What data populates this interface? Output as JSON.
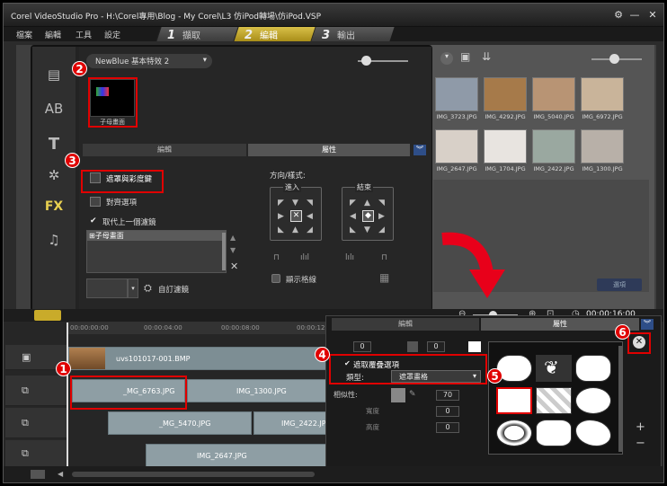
{
  "window": {
    "title": "Corel VideoStudio Pro - H:\\Corel專用\\Blog - My Corel\\L3 仿iPod轉場\\仿iPod.VSP",
    "minimize": "—",
    "restore": "□",
    "close": "✕"
  },
  "menu": {
    "items": [
      "檔案",
      "編輯",
      "工具",
      "設定"
    ]
  },
  "steps": [
    {
      "num": "1",
      "label": "擷取"
    },
    {
      "num": "2",
      "label": "編輯"
    },
    {
      "num": "3",
      "label": "輸出"
    }
  ],
  "library": {
    "thumbs": [
      {
        "label": "IMG_3723.JPG",
        "color": "#8f9aa8"
      },
      {
        "label": "IMG_4292.JPG",
        "color": "#a67a4a"
      },
      {
        "label": "IMG_5040.JPG",
        "color": "#b89474"
      },
      {
        "label": "IMG_6972.JPG",
        "color": "#c9b49a"
      },
      {
        "label": "IMG_2647.JPG",
        "color": "#d8d0c8"
      },
      {
        "label": "IMG_1704.JPG",
        "color": "#e8e4e0"
      },
      {
        "label": "IMG_2422.JPG",
        "color": "#9aa8a0"
      },
      {
        "label": "IMG_1300.JPG",
        "color": "#b8b0a8"
      }
    ],
    "options_button": "選項"
  },
  "fx_panel": {
    "effect_dropdown": "NewBlue 基本特效 2",
    "effect_thumb_label": "子母畫面",
    "tabs": [
      "編輯",
      "屬性"
    ],
    "mask_chroma_button": "遮罩與彩度鍵",
    "align_options": "對齊選項",
    "replace_filter": "取代上一個濾鏡",
    "filter_list_item": "子母畫面",
    "custom_filter": "自訂濾鏡",
    "direction_style": "方向/樣式:",
    "enter_label": "進入",
    "exit_label": "結束",
    "show_grid": "顯示格線"
  },
  "edit_panel": {
    "tabs": [
      "編輯",
      "屬性"
    ],
    "overlay_options": "遮取覆疊選項",
    "type_label": "類型:",
    "type_value": "遮罩畫格",
    "similarity_label": "相似性:",
    "width_label": "寬度",
    "height_label": "高度",
    "values": [
      "0",
      "0",
      "70",
      "0",
      "0"
    ]
  },
  "timeline": {
    "timecode": "00:00:16:00",
    "ruler": [
      "00:00:00:00",
      "00:00:04:00",
      "00:00:08:00",
      "00:00:12"
    ],
    "video_clip": "uvs101017-001.BMP",
    "overlay1": [
      "_MG_6763.JPG",
      "IMG_1300.JPG"
    ],
    "overlay2": [
      "_MG_5470.JPG",
      "IMG_2422.JPG"
    ],
    "overlay3": [
      "IMG_2647.JPG"
    ]
  },
  "badges": [
    "1",
    "2",
    "3",
    "4",
    "5",
    "6"
  ],
  "colors": {
    "accent_yellow": "#c9ab2a",
    "highlight_red": "#e00000",
    "arrow_red": "#e8001a"
  }
}
